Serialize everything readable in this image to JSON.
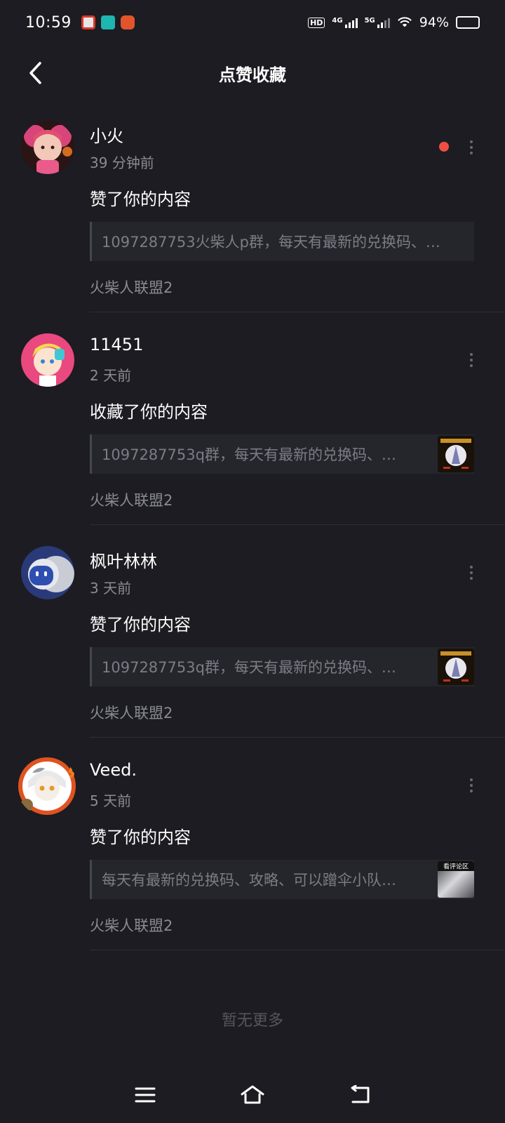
{
  "status_bar": {
    "time": "10:59",
    "hd_label": "HD",
    "net1_label": "4G",
    "net2_label": "5G",
    "battery": "94%"
  },
  "header": {
    "title": "点赞收藏"
  },
  "notifications": [
    {
      "user_name": "小火",
      "time": "39 分钟前",
      "action": "赞了你的内容",
      "quote": "1097287753火柴人p群，每天有最新的兑换码、…",
      "source": "火柴人联盟2",
      "unread": true,
      "has_thumb": false
    },
    {
      "user_name": "11451",
      "time": "2 天前",
      "action": "收藏了你的内容",
      "quote": "1097287753q群，每天有最新的兑换码、…",
      "source": "火柴人联盟2",
      "unread": false,
      "has_thumb": true
    },
    {
      "user_name": "枫叶林林",
      "time": "3 天前",
      "action": "赞了你的内容",
      "quote": "1097287753q群，每天有最新的兑换码、…",
      "source": "火柴人联盟2",
      "unread": false,
      "has_thumb": true
    },
    {
      "user_name": "Veed.",
      "time": "5 天前",
      "action": "赞了你的内容",
      "quote": "每天有最新的兑换码、攻略、可以蹭伞小队…",
      "source": "火柴人联盟2",
      "unread": false,
      "has_thumb": true,
      "thumb_label": "看评论区"
    }
  ],
  "footer": {
    "end_text": "暂无更多"
  },
  "colors": {
    "background": "#1c1c22",
    "unread_dot": "#f04e45",
    "secondary_text": "#8b8b93"
  }
}
